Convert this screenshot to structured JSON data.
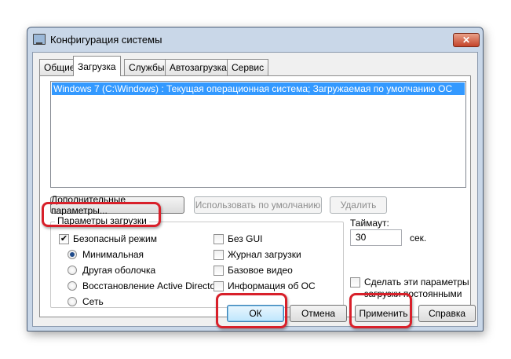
{
  "window": {
    "title": "Конфигурация системы",
    "close_glyph": "✕"
  },
  "tabs": [
    {
      "label": "Общие",
      "active": false
    },
    {
      "label": "Загрузка",
      "active": true
    },
    {
      "label": "Службы",
      "active": false
    },
    {
      "label": "Автозагрузка",
      "active": false
    },
    {
      "label": "Сервис",
      "active": false
    }
  ],
  "os_list": {
    "items": [
      "Windows 7 (C:\\Windows) : Текущая операционная система; Загружаемая по умолчанию ОС"
    ],
    "selected": 0
  },
  "list_buttons": {
    "advanced": "Дополнительные параметры...",
    "set_default": "Использовать по умолчанию",
    "delete": "Удалить"
  },
  "boot_options": {
    "group_label": "Параметры загрузки",
    "safe_boot": {
      "label": "Безопасный режим",
      "checked": true
    },
    "radios": [
      {
        "label": "Минимальная",
        "selected": true
      },
      {
        "label": "Другая оболочка",
        "selected": false
      },
      {
        "label": "Восстановление Active Directory",
        "selected": false
      },
      {
        "label": "Сеть",
        "selected": false
      }
    ],
    "checks": [
      {
        "label": "Без GUI",
        "checked": false
      },
      {
        "label": "Журнал загрузки",
        "checked": false
      },
      {
        "label": "Базовое видео",
        "checked": false
      },
      {
        "label": "Информация  об ОС",
        "checked": false
      }
    ]
  },
  "timeout": {
    "label": "Таймаут:",
    "value": "30",
    "unit": "сек."
  },
  "permanent": {
    "label_line1": "Сделать эти параметры",
    "label_line2": "загрузки постоянными",
    "checked": false
  },
  "dialog_buttons": {
    "ok": "ОК",
    "cancel": "Отмена",
    "apply": "Применить",
    "help": "Справка"
  },
  "colors": {
    "selection": "#3399ff",
    "annotation_ring": "#d8202a",
    "title_bar": "#c9d7e8"
  }
}
